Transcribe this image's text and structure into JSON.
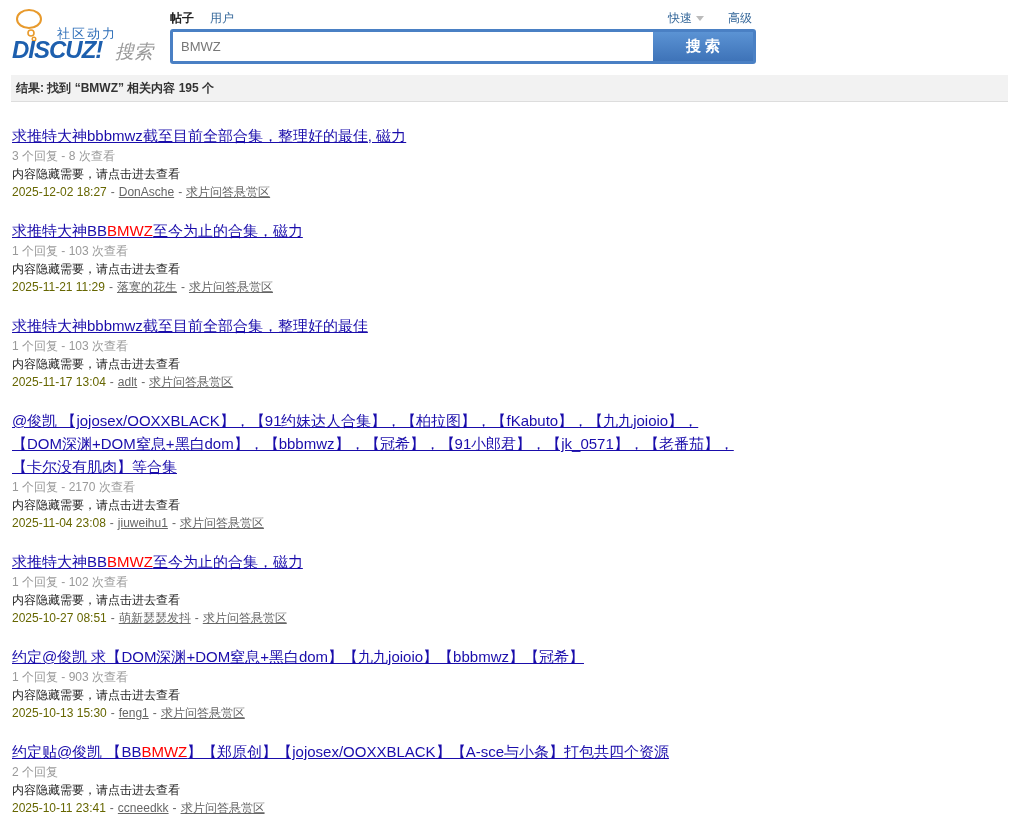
{
  "logo": {
    "tagline": "社区动力",
    "brand": "DISCUZ!",
    "suffix": "搜索"
  },
  "search_tabs": [
    {
      "label": "帖子",
      "selected": true
    },
    {
      "label": "用户",
      "selected": false
    }
  ],
  "quick_link": "快速",
  "advanced_link": "高级",
  "search": {
    "value": "BMWZ",
    "button": "搜 索"
  },
  "result_summary": "结果: 找到 “BMWZ” 相关内容 195 个",
  "results": [
    {
      "title": [
        {
          "text": "求推特大神bbbmwz截至目前全部合集，整理好的最佳, 磁力",
          "highlight": false
        }
      ],
      "stats": "3 个回复 - 8 次查看",
      "excerpt": "内容隐藏需要，请点击进去查看",
      "date": "2025-12-02 18:27",
      "separators": [
        "-",
        "-"
      ],
      "author": "DonAsche",
      "forum": "求片问答悬赏区"
    },
    {
      "title": [
        {
          "text": "求推特大神BB",
          "highlight": false
        },
        {
          "text": "BMWZ",
          "highlight": true
        },
        {
          "text": "至今为止的合集，磁力",
          "highlight": false
        }
      ],
      "stats": "1 个回复 - 103 次查看",
      "excerpt": "内容隐藏需要，请点击进去查看",
      "date": "2025-11-21 11:29",
      "separators": [
        "-",
        "-"
      ],
      "author": "落寞的花生",
      "forum": "求片问答悬赏区"
    },
    {
      "title": [
        {
          "text": "求推特大神bbbmwz截至目前全部合集，整理好的最佳",
          "highlight": false
        }
      ],
      "stats": "1 个回复 - 103 次查看",
      "excerpt": "内容隐藏需要，请点击进去查看",
      "date": "2025-11-17 13:04",
      "separators": [
        "-",
        "-"
      ],
      "author": "adlt",
      "forum": "求片问答悬赏区"
    },
    {
      "title": [
        {
          "text": "@俊凯 【jojosex/OOXXBLACK】，【91约妹达人合集】，【柏拉图】，【fKabuto】，【九九joioio】，【DOM深渊+DOM窒息+黑白dom】，【bbbmwz】，【冠希】，【91小郎君】，【jk_0571】，【老番茄】，【卡尔没有肌肉】等合集",
          "highlight": false
        }
      ],
      "stats": "1 个回复 - 2170 次查看",
      "excerpt": "内容隐藏需要，请点击进去查看",
      "date": "2025-11-04 23:08",
      "separators": [
        "-",
        "-"
      ],
      "author": "jiuweihu1",
      "forum": "求片问答悬赏区"
    },
    {
      "title": [
        {
          "text": "求推特大神BB",
          "highlight": false
        },
        {
          "text": "BMWZ",
          "highlight": true
        },
        {
          "text": "至今为止的合集，磁力",
          "highlight": false
        }
      ],
      "stats": "1 个回复 - 102 次查看",
      "excerpt": "内容隐藏需要，请点击进去查看",
      "date": "2025-10-27 08:51",
      "separators": [
        "-",
        "-"
      ],
      "author": "萌新瑟瑟发抖",
      "forum": "求片问答悬赏区"
    },
    {
      "title": [
        {
          "text": "约定@俊凯 求【DOM深渊+DOM窒息+黑白dom】【九九joioio】【bbbmwz】【冠希】",
          "highlight": false
        }
      ],
      "stats": "1 个回复 - 903 次查看",
      "excerpt": "内容隐藏需要，请点击进去查看",
      "date": "2025-10-13 15:30",
      "separators": [
        "-",
        "-"
      ],
      "author": "feng1",
      "forum": "求片问答悬赏区"
    },
    {
      "title": [
        {
          "text": "约定贴@俊凯 【BB",
          "highlight": false
        },
        {
          "text": "BMWZ",
          "highlight": true
        },
        {
          "text": "】【郑原创】【jojosex/OOXXBLACK】【A-sce与小条】打包共四个资源",
          "highlight": false
        }
      ],
      "stats": "2 个回复",
      "excerpt": "内容隐藏需要，请点击进去查看",
      "date": "2025-10-11 23:41",
      "separators": [
        "-",
        "-"
      ],
      "author": "ccneedkk",
      "forum": "求片问答悬赏区"
    }
  ]
}
